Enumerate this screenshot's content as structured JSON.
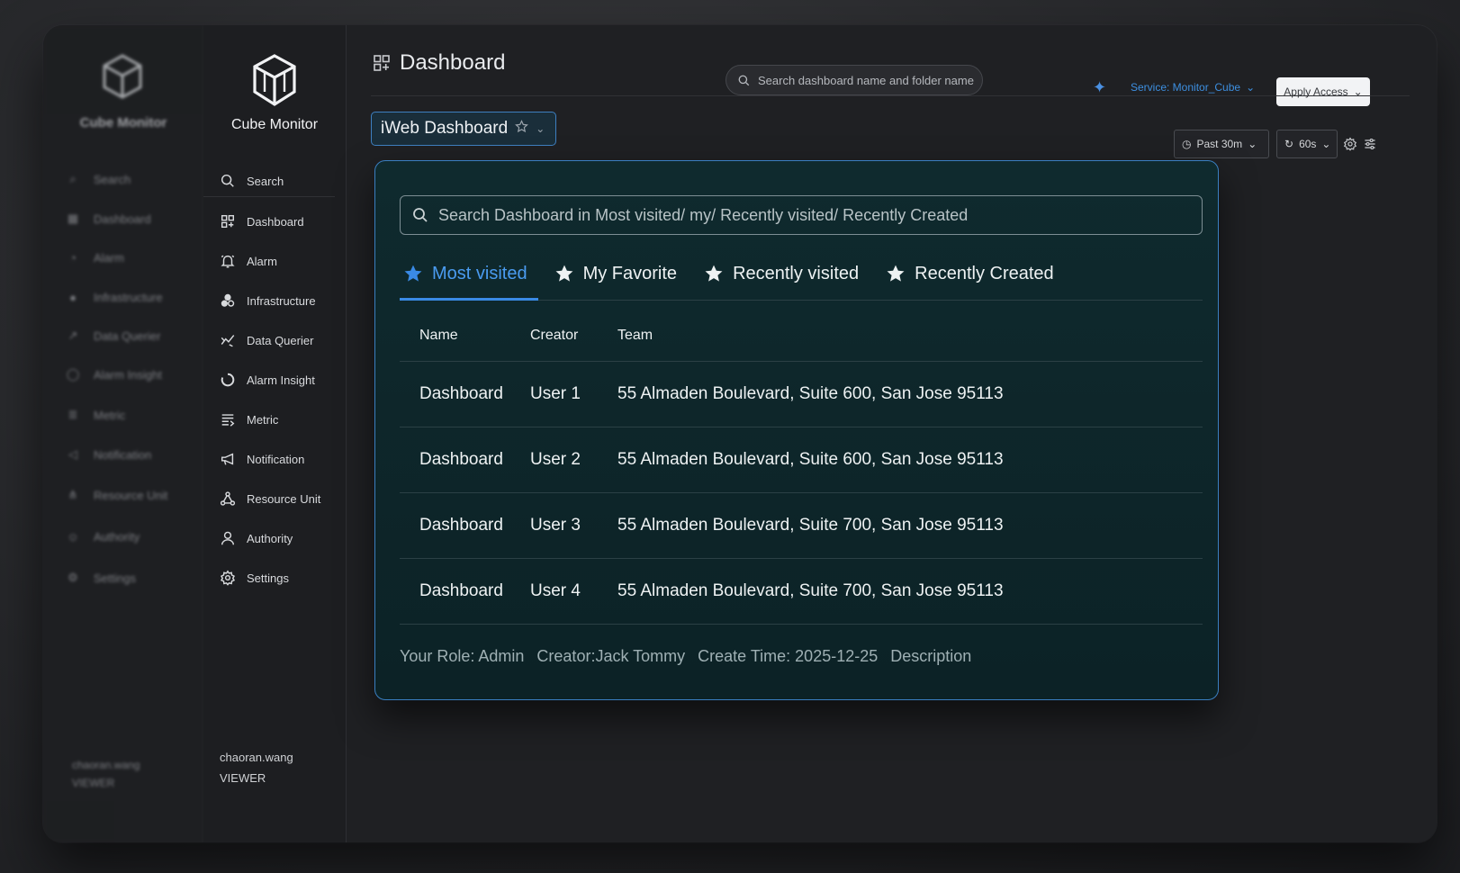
{
  "app": {
    "name": "Cube Monitor"
  },
  "ghost_sidebar": {
    "items": [
      "Search",
      "Dashboard",
      "Alarm",
      "Infrastructure",
      "Data Querier",
      "Alarm Insight",
      "Metric",
      "Notification",
      "Resource Unit",
      "Authority",
      "Settings"
    ],
    "user": "chaoran.wang",
    "role": "VIEWER"
  },
  "sidebar": {
    "items": [
      {
        "label": "Search",
        "icon": "search-icon"
      },
      {
        "label": "Dashboard",
        "icon": "grid-icon"
      },
      {
        "label": "Alarm",
        "icon": "bell-icon"
      },
      {
        "label": "Infrastructure",
        "icon": "cluster-icon"
      },
      {
        "label": "Data Querier",
        "icon": "chart-icon"
      },
      {
        "label": "Alarm Insight",
        "icon": "ring-icon"
      },
      {
        "label": "Metric",
        "icon": "list-icon"
      },
      {
        "label": "Notification",
        "icon": "megaphone-icon"
      },
      {
        "label": "Resource Unit",
        "icon": "nodes-icon"
      },
      {
        "label": "Authority",
        "icon": "user-icon"
      },
      {
        "label": "Settings",
        "icon": "gear-icon"
      }
    ],
    "user": "chaoran.wang",
    "role": "VIEWER"
  },
  "header": {
    "title": "Dashboard",
    "search_placeholder": "Search dashboard name and folder name",
    "service": "Service: Monitor_Cube",
    "apply_access": "Apply Access"
  },
  "toolbar": {
    "dashboard_name": "iWeb Dashboard",
    "time_range": "Past 30m",
    "refresh": "60s"
  },
  "panel": {
    "search_placeholder": "Search Dashboard in Most visited/ my/ Recently visited/ Recently Created",
    "tabs": [
      "Most visited",
      "My Favorite",
      "Recently visited",
      "Recently Created"
    ],
    "columns": [
      "Name",
      "Creator",
      "Team"
    ],
    "rows": [
      {
        "name": "Dashboard",
        "creator": "User 1",
        "team": "55 Almaden Boulevard, Suite 600, San Jose 95113"
      },
      {
        "name": "Dashboard",
        "creator": "User 2",
        "team": "55 Almaden Boulevard, Suite 600, San Jose 95113"
      },
      {
        "name": "Dashboard",
        "creator": "User 3",
        "team": "55 Almaden Boulevard, Suite 700, San Jose 95113"
      },
      {
        "name": "Dashboard",
        "creator": "User 4",
        "team": "55 Almaden Boulevard, Suite 700, San Jose 95113"
      }
    ],
    "footer": {
      "role": "Your Role: Admin",
      "creator": "Creator:Jack Tommy",
      "create_time": "Create Time: 2025-12-25",
      "description": "Description"
    }
  },
  "colors": {
    "accent": "#3a8ae5",
    "panel_bg": "#0f2a2e",
    "sidebar_bg": "#1d1e21"
  }
}
